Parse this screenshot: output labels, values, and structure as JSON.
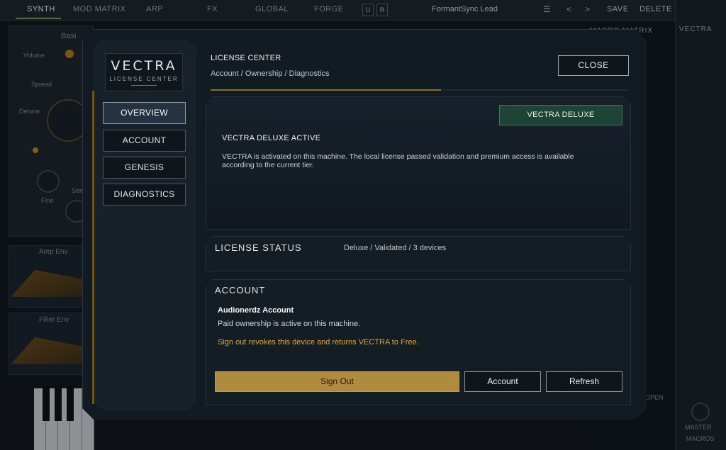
{
  "background": {
    "tabs": [
      "SYNTH",
      "MOD MATRIX",
      "ARP",
      "FX",
      "GLOBAL",
      "FORGE"
    ],
    "mini_buttons": [
      "U",
      "R"
    ],
    "preset_name": "FormantSync Lead",
    "menu_icon": "hamburger-icon",
    "prev_icon": "chevron-left-icon",
    "next_icon": "chevron-right-icon",
    "save_label": "SAVE",
    "delete_label": "DELETE",
    "brand": "VECTRA",
    "labels": {
      "osc": "Basi",
      "volume": "Volume",
      "spread": "Spread",
      "detune": "Detune",
      "fine": "Fine",
      "semi": "Sem",
      "amp_env": "Amp Env",
      "filter_env": "Filter Env",
      "matrix": "MACRO MATRIX",
      "master": "MASTER",
      "macros": "MACROS",
      "open": "OPEN"
    }
  },
  "modal": {
    "brand_title": "VECTRA",
    "brand_sub": "LICENSE CENTER",
    "nav": [
      {
        "label": "OVERVIEW",
        "active": true
      },
      {
        "label": "ACCOUNT",
        "active": false
      },
      {
        "label": "GENESIS",
        "active": false
      },
      {
        "label": "DIAGNOSTICS",
        "active": false
      }
    ],
    "header": {
      "title": "LICENSE CENTER",
      "subtitle": "Account / Ownership / Diagnostics",
      "close_label": "CLOSE",
      "progress": 0.55
    },
    "hero": {
      "badge": "VECTRA DELUXE",
      "title": "VECTRA DELUXE ACTIVE",
      "body": "VECTRA is activated on this machine. The local license passed validation and premium access is available according to the current tier."
    },
    "license_status": {
      "title": "LICENSE STATUS",
      "values": "Deluxe  /  Validated  /  3 devices"
    },
    "account": {
      "title": "ACCOUNT",
      "name": "Audionerdz Account",
      "desc": "Paid ownership is active on this machine.",
      "warning": "Sign out revokes this device and returns VECTRA to Free.",
      "sign_out_label": "Sign Out",
      "account_label": "Account",
      "refresh_label": "Refresh"
    },
    "colors": {
      "accent_gold": "#b08a3e",
      "badge_green": "#1d4436",
      "warning": "#d9a73c"
    }
  }
}
